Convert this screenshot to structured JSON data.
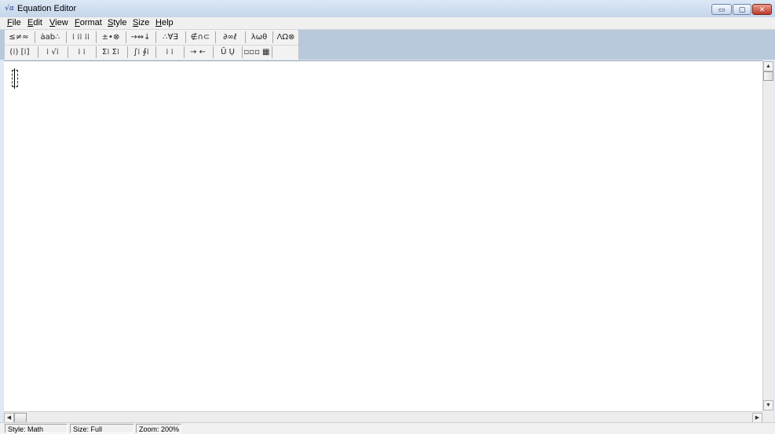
{
  "window": {
    "title": "Equation Editor",
    "app_icon_glyph": "√α",
    "controls": {
      "minimize": "▭",
      "maximize": "▢",
      "close": "✕"
    }
  },
  "menu": [
    "File",
    "Edit",
    "View",
    "Format",
    "Style",
    "Size",
    "Help"
  ],
  "palette": {
    "row1": [
      "≤≠≈",
      "ȧab∴",
      "⁞ ⁞⁞ ⁞⁞",
      "±•⊗",
      "→⇔↓",
      "∴∀∃",
      "∉∩⊂",
      "∂∞ℓ",
      "λωθ",
      "ΛΩ⊗"
    ],
    "row2": [
      "(⁞) [⁞]",
      "⁞ √⁞",
      "⁞ ⁞",
      "Σ⁞ Σ⁞",
      "∫⁞ ∮⁞",
      "⁞ ⁞",
      "→ ←",
      "Ū Ụ",
      "▫▫▫ ▦"
    ]
  },
  "statusbar": {
    "style": "Style: Math",
    "size": "Size: Full",
    "zoom": "Zoom: 200%"
  },
  "scroll": {
    "up": "▲",
    "down": "▼",
    "left": "◀",
    "right": "▶"
  },
  "colors": {
    "title_gradient_top": "#dbe7f5",
    "close_button": "#c0392b"
  }
}
